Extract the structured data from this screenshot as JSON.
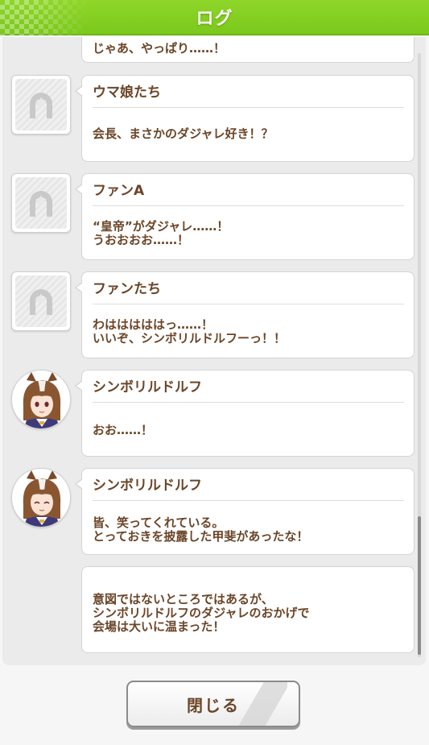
{
  "header": {
    "title": "ログ"
  },
  "log": {
    "entries": [
      {
        "speaker": "",
        "text": "じゃあ、やっぱり……！",
        "avatar": ""
      },
      {
        "speaker": "ウマ娘たち",
        "text": "会長、まさかのダジャレ好き！？",
        "avatar": "placeholder-horseshoe-icon"
      },
      {
        "speaker": "ファンA",
        "text": "“皇帝”がダジャレ……！\nうおおおお……！",
        "avatar": "placeholder-horseshoe-icon"
      },
      {
        "speaker": "ファンたち",
        "text": "わはははははっ……！\nいいぞ、シンボリルドルフーっ！！",
        "avatar": "placeholder-horseshoe-icon"
      },
      {
        "speaker": "シンボリルドルフ",
        "text": "おお……！",
        "avatar": "character-portrait"
      },
      {
        "speaker": "シンボリルドルフ",
        "text": "皆、笑ってくれている。\nとっておきを披露した甲斐があったな！",
        "avatar": "character-portrait"
      },
      {
        "speaker": "",
        "text": "意図ではないところではあるが、\nシンボリルドルフのダジャレのおかげで\n会場は大いに温まった！",
        "avatar": ""
      }
    ]
  },
  "footer": {
    "close_label": "閉じる"
  },
  "colors": {
    "header_green": "#86cf22",
    "text_brown": "#6b4528",
    "panel_bg": "#ebebeb"
  }
}
